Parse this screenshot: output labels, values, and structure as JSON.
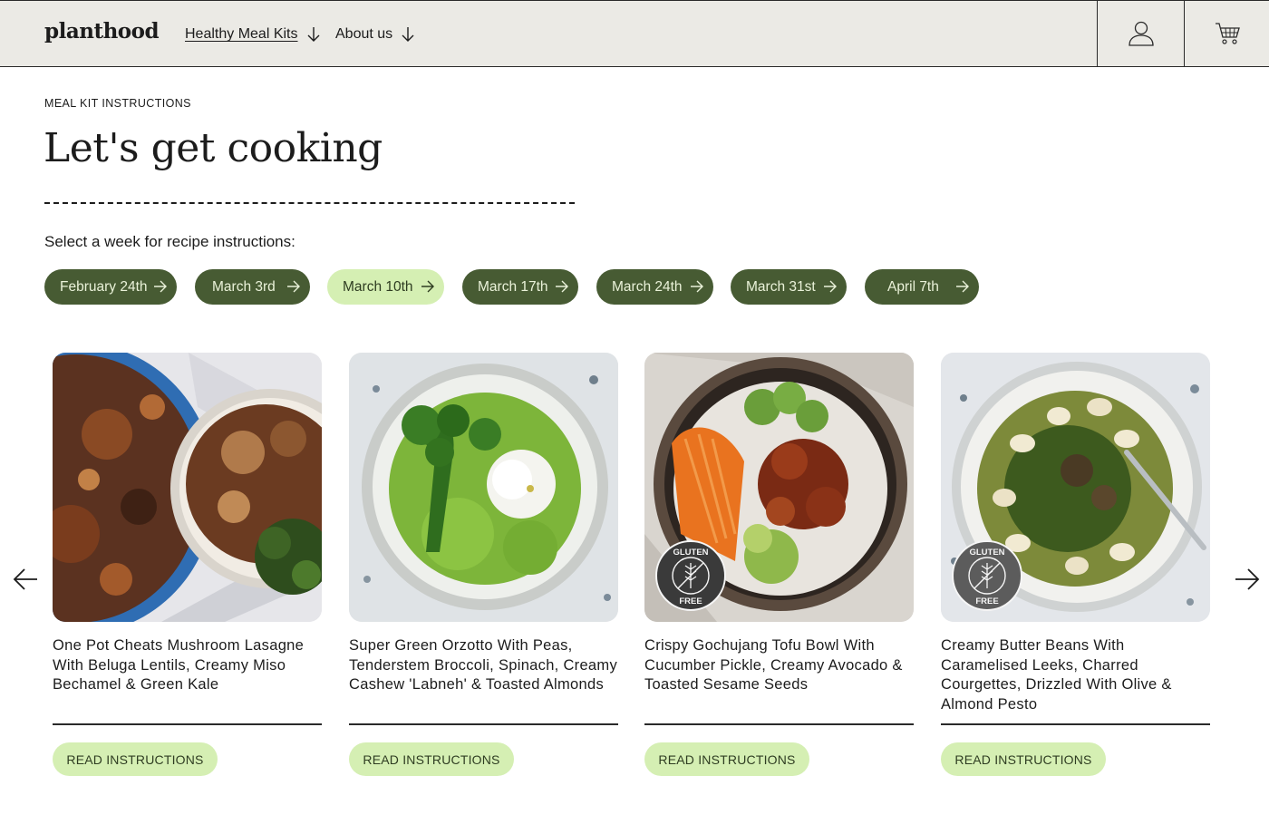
{
  "header": {
    "logo": "planthood",
    "nav": [
      {
        "label": "Healthy Meal Kits",
        "icon": "arrow-down-icon"
      },
      {
        "label": "About us",
        "icon": "arrow-down-icon"
      }
    ],
    "account_icon": "user-icon",
    "cart_icon": "cart-icon"
  },
  "hero": {
    "eyebrow": "MEAL KIT INSTRUCTIONS",
    "title": "Let's get cooking",
    "select_label": "Select a week for recipe instructions:"
  },
  "weeks": [
    {
      "label": "February 24th",
      "selected": false
    },
    {
      "label": "March 3rd",
      "selected": false
    },
    {
      "label": "March 10th",
      "selected": true
    },
    {
      "label": "March 17th",
      "selected": false
    },
    {
      "label": "March 24th",
      "selected": false
    },
    {
      "label": "March 31st",
      "selected": false
    },
    {
      "label": "April 7th",
      "selected": false
    }
  ],
  "carousel": {
    "prev_icon": "arrow-left-icon",
    "next_icon": "arrow-right-icon"
  },
  "recipes": [
    {
      "title": "One Pot Cheats Mushroom Lasagne With Beluga Lentils, Creamy Miso Bechamel & Green Kale",
      "button": "READ INSTRUCTIONS",
      "gluten_free": false
    },
    {
      "title": "Super Green Orzotto With Peas, Tenderstem Broccoli, Spinach, Creamy Cashew 'Labneh' & Toasted Almonds",
      "button": "READ INSTRUCTIONS",
      "gluten_free": false
    },
    {
      "title": "Crispy Gochujang Tofu Bowl With Cucumber Pickle, Creamy Avocado & Toasted Sesame Seeds",
      "button": "READ INSTRUCTIONS",
      "gluten_free": true
    },
    {
      "title": "Creamy Butter Beans With Caramelised Leeks, Charred Courgettes, Drizzled With Olive & Almond Pesto",
      "button": "READ INSTRUCTIONS",
      "gluten_free": true
    }
  ],
  "badge": {
    "top": "GLUTEN",
    "bottom": "FREE"
  },
  "colors": {
    "header_bg": "#ebeae5",
    "pill_dark": "#475b33",
    "pill_light": "#d5efb3"
  }
}
